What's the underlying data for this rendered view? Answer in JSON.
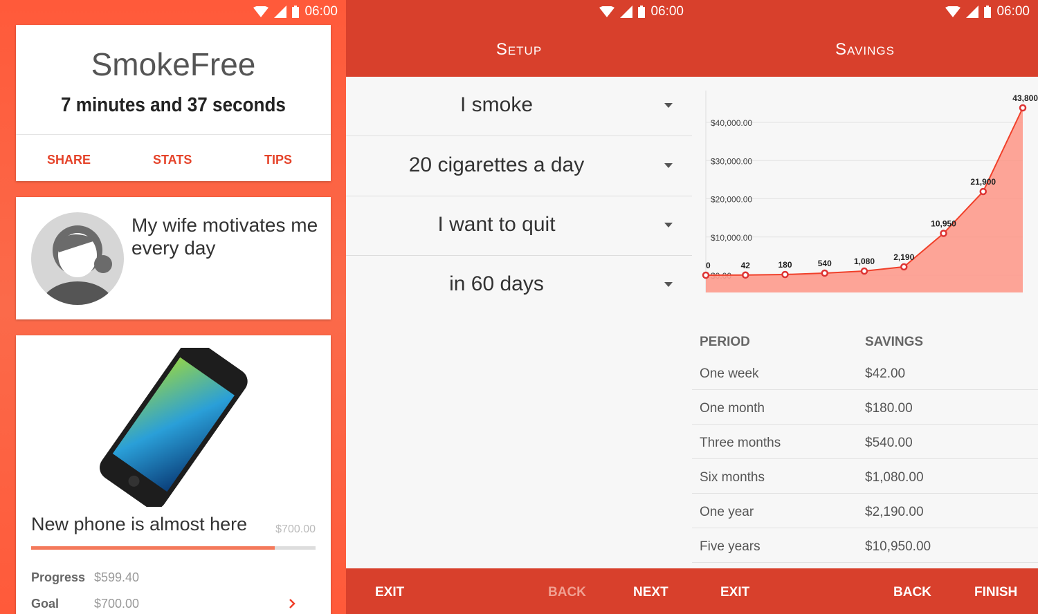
{
  "status": {
    "time": "06:00"
  },
  "home": {
    "app_name": "SmokeFree",
    "elapsed": "7 minutes and 37 seconds",
    "actions": [
      "SHARE",
      "STATS",
      "TIPS"
    ],
    "motivation": "My wife motivates me every day",
    "goal": {
      "title": "New phone is almost here",
      "amount": "$700.00",
      "progress_fraction": 0.856,
      "progress_label": "Progress",
      "progress_value": "$599.40",
      "goal_label": "Goal",
      "goal_value": "$700.00"
    }
  },
  "setup": {
    "title": "Setup",
    "fields": [
      "I smoke",
      "20 cigarettes a day",
      "I want to quit",
      "in 60 days"
    ],
    "exit": "EXIT",
    "back": "BACK",
    "next": "NEXT"
  },
  "savings": {
    "title": "Savings",
    "exit": "EXIT",
    "back": "BACK",
    "finish": "FINISH",
    "table": {
      "headers": [
        "PERIOD",
        "SAVINGS"
      ],
      "rows": [
        [
          "One week",
          "$42.00"
        ],
        [
          "One month",
          "$180.00"
        ],
        [
          "Three months",
          "$540.00"
        ],
        [
          "Six months",
          "$1,080.00"
        ],
        [
          "One year",
          "$2,190.00"
        ],
        [
          "Five years",
          "$10,950.00"
        ]
      ]
    }
  },
  "chart_data": {
    "type": "area",
    "values": [
      0,
      42,
      180,
      540,
      1080,
      2190,
      10950,
      21900,
      43800
    ],
    "data_labels": [
      "0",
      "42",
      "180",
      "540",
      "1,080",
      "2,190",
      "10,950",
      "21,900",
      "43,800"
    ],
    "y_ticks": [
      "$0.00",
      "$10,000.00",
      "$20,000.00",
      "$30,000.00",
      "$40,000.00"
    ],
    "ylim": [
      0,
      40000
    ],
    "grid": true,
    "colors": {
      "line": "#f0402a",
      "fill": "#fd9a8c"
    }
  }
}
